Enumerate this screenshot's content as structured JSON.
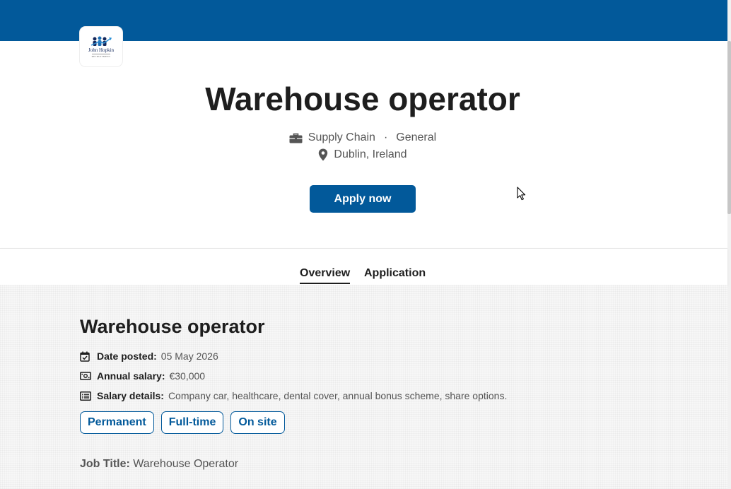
{
  "header": {
    "logo_name": "John Hopkin",
    "logo_tagline": "RECRUITMENT",
    "brand_color": "#02599a"
  },
  "job": {
    "title": "Warehouse operator",
    "department": "Supply Chain",
    "category": "General",
    "location": "Dublin, Ireland",
    "meta_separator": "·",
    "apply_label": "Apply now"
  },
  "tabs": [
    {
      "label": "Overview",
      "active": true
    },
    {
      "label": "Application",
      "active": false
    }
  ],
  "overview": {
    "heading": "Warehouse operator",
    "details": [
      {
        "icon": "calendar-check-icon",
        "label": "Date posted:",
        "value": "05 May 2026"
      },
      {
        "icon": "banknote-icon",
        "label": "Annual salary:",
        "value": "€30,000"
      },
      {
        "icon": "list-icon",
        "label": "Salary details:",
        "value": "Company car, healthcare, dental cover, annual bonus scheme, share options."
      }
    ],
    "chips": [
      "Permanent",
      "Full-time",
      "On site"
    ],
    "job_title_label": "Job Title:",
    "job_title_value": "Warehouse Operator"
  },
  "icons": {
    "department": "briefcase-icon",
    "location": "map-pin-icon"
  }
}
